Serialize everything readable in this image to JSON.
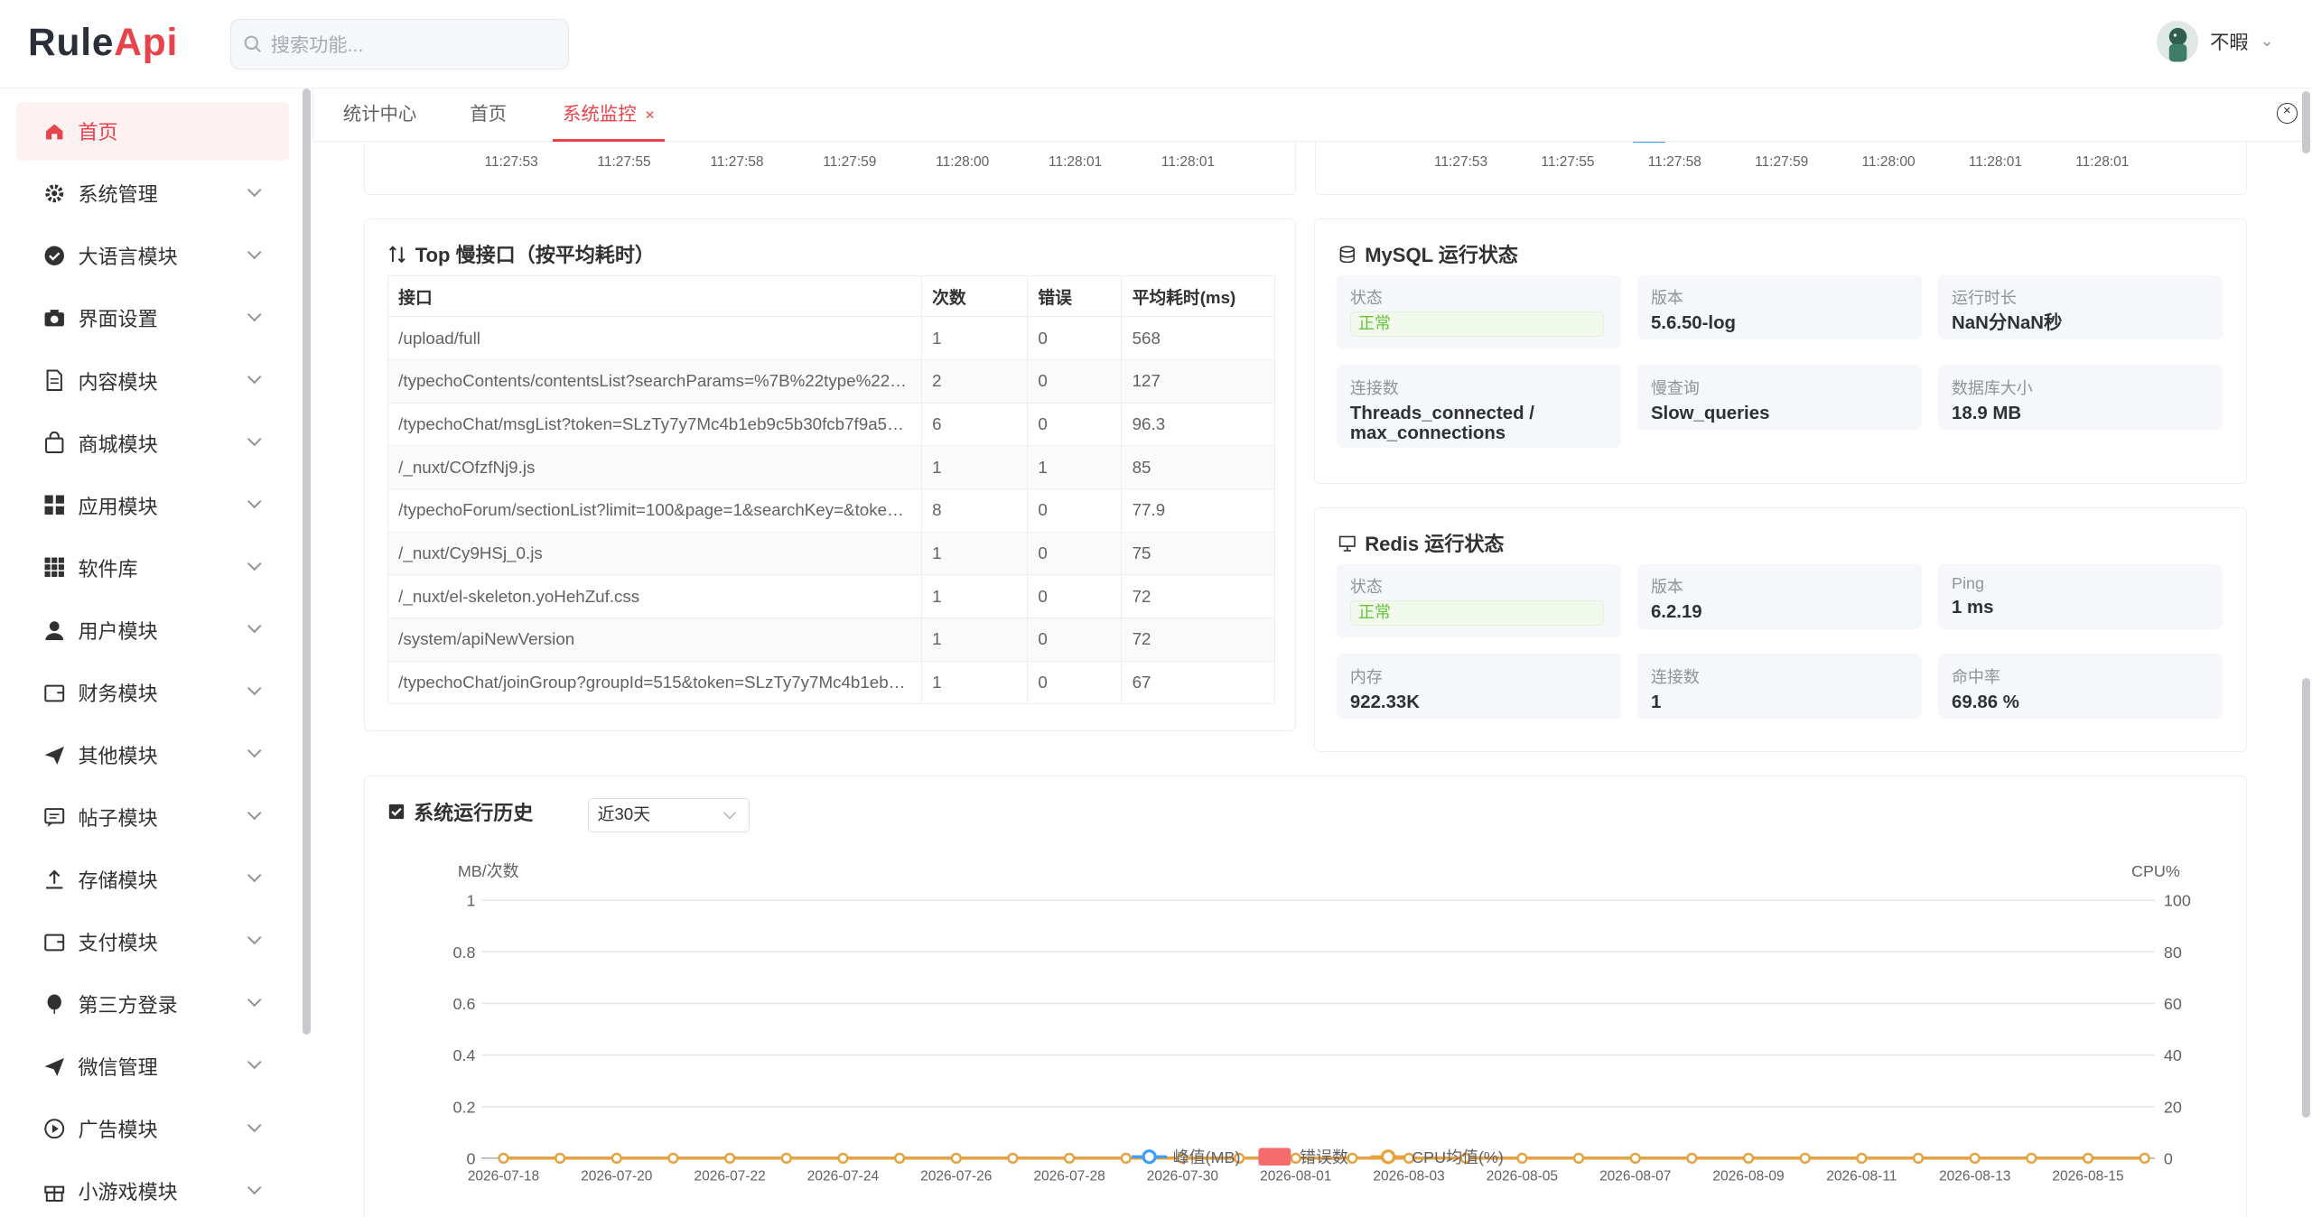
{
  "header": {
    "logo_main": "Rule",
    "logo_accent": "Api",
    "search_placeholder": "搜索功能...",
    "user_name": "不暇"
  },
  "sidebar": {
    "items": [
      {
        "label": "首页",
        "icon": "home-icon",
        "active": true
      },
      {
        "label": "系统管理",
        "icon": "gear-icon"
      },
      {
        "label": "大语言模块",
        "icon": "check-circle-icon"
      },
      {
        "label": "界面设置",
        "icon": "camera-icon"
      },
      {
        "label": "内容模块",
        "icon": "document-icon"
      },
      {
        "label": "商城模块",
        "icon": "shopping-bag-icon"
      },
      {
        "label": "应用模块",
        "icon": "grid-icon"
      },
      {
        "label": "软件库",
        "icon": "apps-icon"
      },
      {
        "label": "用户模块",
        "icon": "user-icon"
      },
      {
        "label": "财务模块",
        "icon": "wallet-icon"
      },
      {
        "label": "其他模块",
        "icon": "send-icon"
      },
      {
        "label": "帖子模块",
        "icon": "chat-icon"
      },
      {
        "label": "存储模块",
        "icon": "upload-icon"
      },
      {
        "label": "支付模块",
        "icon": "wallet-icon"
      },
      {
        "label": "第三方登录",
        "icon": "balloon-icon"
      },
      {
        "label": "微信管理",
        "icon": "send-icon"
      },
      {
        "label": "广告模块",
        "icon": "play-circle-icon"
      },
      {
        "label": "小游戏模块",
        "icon": "gift-icon"
      }
    ]
  },
  "tabs": [
    {
      "label": "统计中心"
    },
    {
      "label": "首页"
    },
    {
      "label": "系统监控",
      "active": true,
      "close": "×"
    }
  ],
  "top_charts": {
    "left_ticks": [
      "11:27:53",
      "11:27:55",
      "11:27:58",
      "11:27:59",
      "11:28:00",
      "11:28:01",
      "11:28:01"
    ],
    "right_ticks": [
      "11:27:53",
      "11:27:55",
      "11:27:58",
      "11:27:59",
      "11:28:00",
      "11:28:01",
      "11:28:01"
    ]
  },
  "slow_api": {
    "title": "Top 慢接口（按平均耗时）",
    "columns": [
      "接口",
      "次数",
      "错误",
      "平均耗时(ms)"
    ],
    "rows": [
      [
        "/upload/full",
        "1",
        "0",
        "568"
      ],
      [
        "/typechoContents/contentsList?searchParams=%7B%22type%22…",
        "2",
        "0",
        "127"
      ],
      [
        "/typechoChat/msgList?token=SLzTy7y7Mc4b1eb9c5b30fcb7f9a5…",
        "6",
        "0",
        "96.3"
      ],
      [
        "/_nuxt/COfzfNj9.js",
        "1",
        "1",
        "85"
      ],
      [
        "/typechoForum/sectionList?limit=100&page=1&searchKey=&toke…",
        "8",
        "0",
        "77.9"
      ],
      [
        "/_nuxt/Cy9HSj_0.js",
        "1",
        "0",
        "75"
      ],
      [
        "/_nuxt/el-skeleton.yoHehZuf.css",
        "1",
        "0",
        "72"
      ],
      [
        "/system/apiNewVersion",
        "1",
        "0",
        "72"
      ],
      [
        "/typechoChat/joinGroup?groupId=515&token=SLzTy7y7Mc4b1eb…",
        "1",
        "0",
        "67"
      ]
    ]
  },
  "mysql": {
    "title": "MySQL 运行状态",
    "status_label": "状态",
    "status_value": "正常",
    "version_label": "版本",
    "version_value": "5.6.50-log",
    "uptime_label": "运行时长",
    "uptime_value": "NaN分NaN秒",
    "conn_label": "连接数",
    "conn_value": "Threads_connected / max_connections",
    "slow_label": "慢查询",
    "slow_value": "Slow_queries",
    "size_label": "数据库大小",
    "size_value": "18.9 MB"
  },
  "redis": {
    "title": "Redis 运行状态",
    "status_label": "状态",
    "status_value": "正常",
    "version_label": "版本",
    "version_value": "6.2.19",
    "ping_label": "Ping",
    "ping_value": "1 ms",
    "mem_label": "内存",
    "mem_value": "922.33K",
    "conn_label": "连接数",
    "conn_value": "1",
    "hit_label": "命中率",
    "hit_value": "69.86 %"
  },
  "history": {
    "title": "系统运行历史",
    "range": "近30天",
    "colors": {
      "peak": "#409eff",
      "errors": "#f56c6c",
      "cpu": "#e6a23c"
    }
  },
  "chart_data": {
    "type": "line",
    "title": "",
    "ylabel": "MB/次数",
    "y2label": "CPU%",
    "ylim": [
      0,
      1
    ],
    "y2lim": [
      0,
      100
    ],
    "yticks": [
      "1",
      "0.8",
      "0.6",
      "0.4",
      "0.2",
      "0"
    ],
    "y2ticks": [
      "100",
      "80",
      "60",
      "40",
      "20",
      "0"
    ],
    "x_tick_labels": [
      "2026-07-18",
      "2026-07-20",
      "2026-07-22",
      "2026-07-24",
      "2026-07-26",
      "2026-07-28",
      "2026-07-30",
      "2026-08-01",
      "2026-08-03",
      "2026-08-05",
      "2026-08-07",
      "2026-08-09",
      "2026-08-11",
      "2026-08-13",
      "2026-08-15"
    ],
    "x": [
      "2026-07-18",
      "2026-07-19",
      "2026-07-20",
      "2026-07-21",
      "2026-07-22",
      "2026-07-23",
      "2026-07-24",
      "2026-07-25",
      "2026-07-26",
      "2026-07-27",
      "2026-07-28",
      "2026-07-29",
      "2026-07-30",
      "2026-07-31",
      "2026-08-01",
      "2026-08-02",
      "2026-08-03",
      "2026-08-04",
      "2026-08-05",
      "2026-08-06",
      "2026-08-07",
      "2026-08-08",
      "2026-08-09",
      "2026-08-10",
      "2026-08-11",
      "2026-08-12",
      "2026-08-13",
      "2026-08-14",
      "2026-08-15",
      "2026-08-16"
    ],
    "series": [
      {
        "name": "峰值(MB)",
        "values": [
          0,
          0,
          0,
          0,
          0,
          0,
          0,
          0,
          0,
          0,
          0,
          0,
          0,
          0,
          0,
          0,
          0,
          0,
          0,
          0,
          0,
          0,
          0,
          0,
          0,
          0,
          0,
          0,
          0,
          0
        ]
      },
      {
        "name": "错误数",
        "values": [
          0,
          0,
          0,
          0,
          0,
          0,
          0,
          0,
          0,
          0,
          0,
          0,
          0,
          0,
          0,
          0,
          0,
          0,
          0,
          0,
          0,
          0,
          0,
          0,
          0,
          0,
          0,
          0,
          0,
          0
        ]
      },
      {
        "name": "CPU均值(%)",
        "axis": "right",
        "values": [
          0,
          0,
          0,
          0,
          0,
          0,
          0,
          0,
          0,
          0,
          0,
          0,
          0,
          0,
          0,
          0,
          0,
          0,
          0,
          0,
          0,
          0,
          0,
          0,
          0,
          0,
          0,
          0,
          0,
          0
        ]
      }
    ],
    "legend": "bottom-center",
    "grid": true
  }
}
